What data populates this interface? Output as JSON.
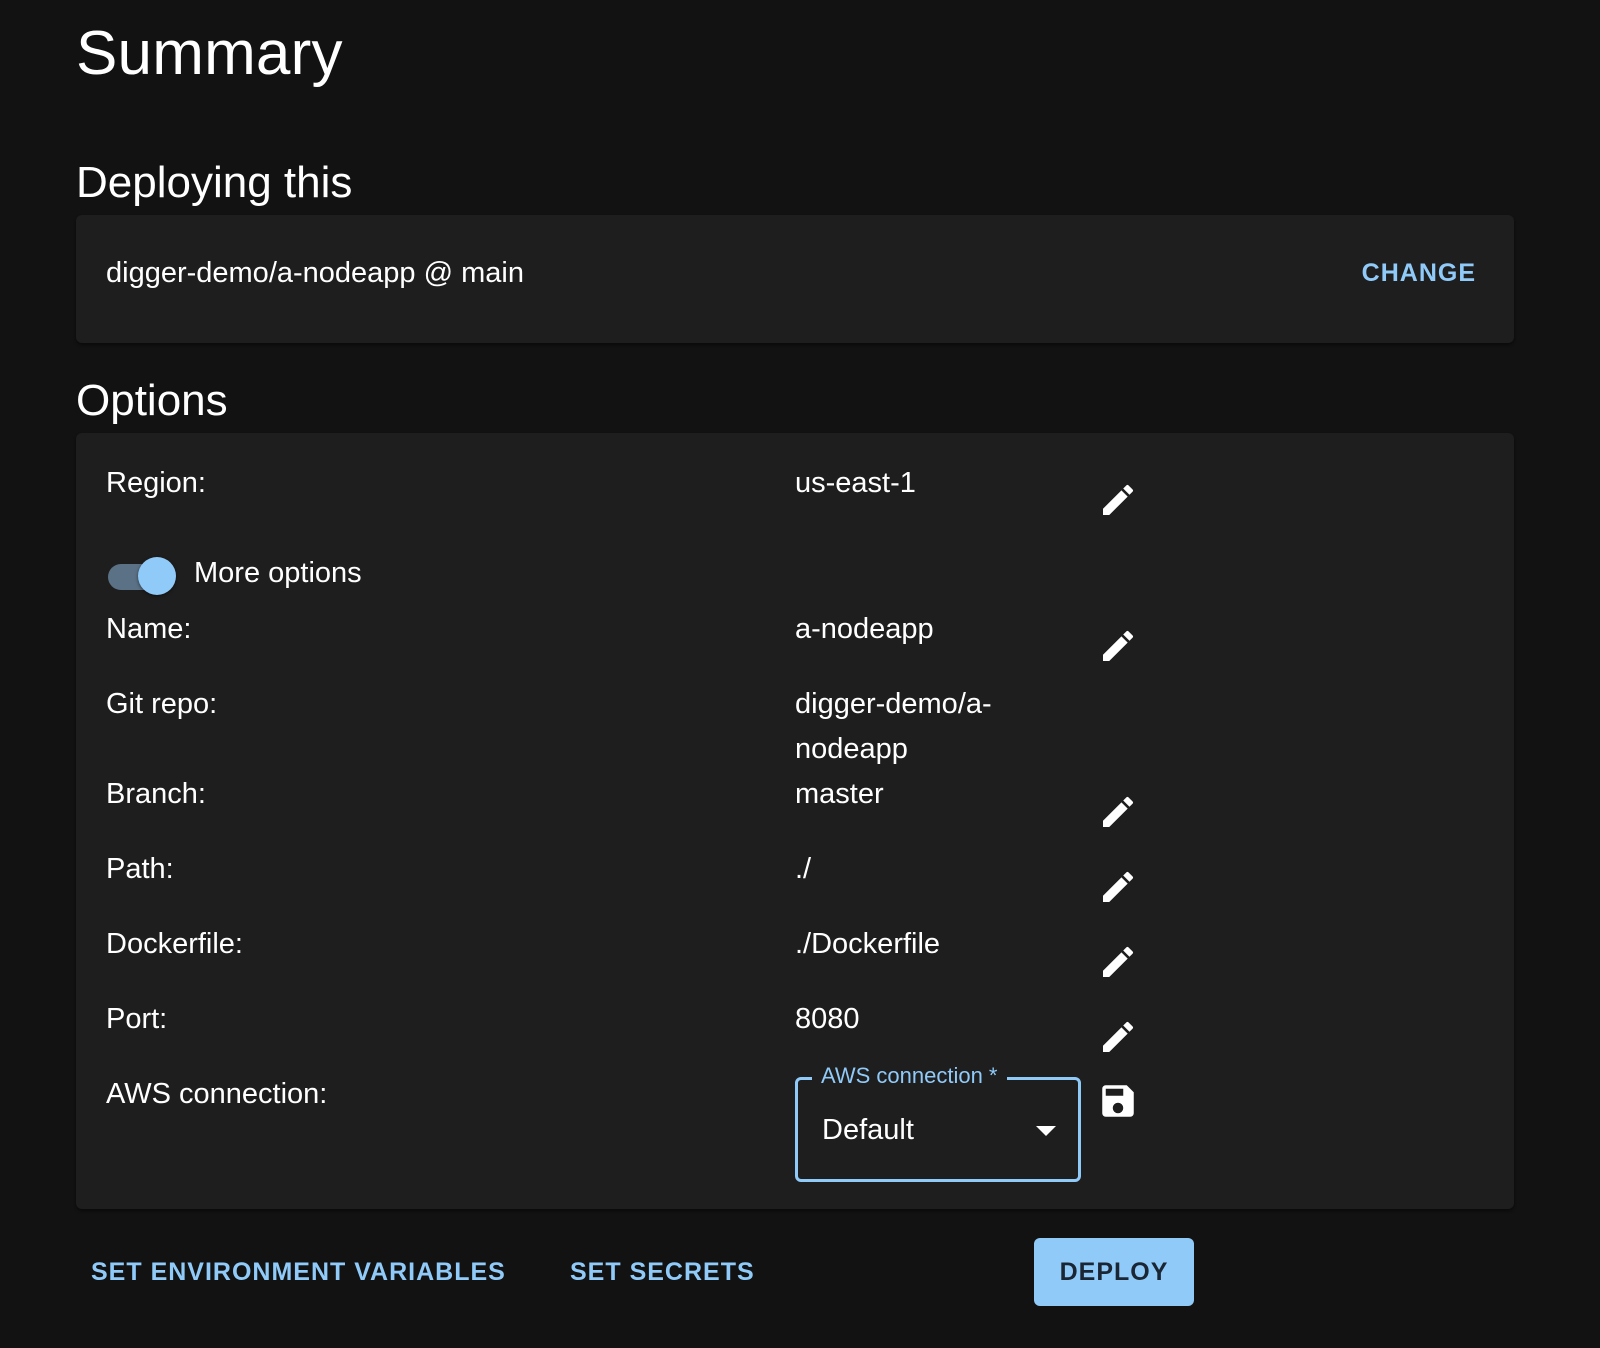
{
  "header": {
    "title": "Summary"
  },
  "deploying": {
    "section_title": "Deploying this",
    "source": "digger-demo/a-nodeapp @ main",
    "change_label": "CHANGE"
  },
  "options": {
    "section_title": "Options",
    "region": {
      "label": "Region:",
      "value": "us-east-1"
    },
    "more_options": {
      "label": "More options",
      "enabled": true
    },
    "name": {
      "label": "Name:",
      "value": "a-nodeapp"
    },
    "git_repo": {
      "label": "Git repo:",
      "value": "digger-demo/a-nodeapp"
    },
    "branch": {
      "label": "Branch:",
      "value": "master"
    },
    "path": {
      "label": "Path:",
      "value": "./"
    },
    "dockerfile": {
      "label": "Dockerfile:",
      "value": "./Dockerfile"
    },
    "port": {
      "label": "Port:",
      "value": "8080"
    },
    "aws_connection": {
      "label": "AWS connection:",
      "field_label": "AWS connection *",
      "value": "Default"
    }
  },
  "actions": {
    "env_vars_label": "SET ENVIRONMENT VARIABLES",
    "secrets_label": "SET SECRETS",
    "deploy_label": "DEPLOY"
  },
  "colors": {
    "background": "#121212",
    "card": "#1e1e1e",
    "accent": "#90caf9",
    "text": "#ffffff"
  },
  "icons": {
    "edit": "pencil-icon",
    "save": "floppy-disk-icon",
    "dropdown": "caret-down-icon"
  }
}
